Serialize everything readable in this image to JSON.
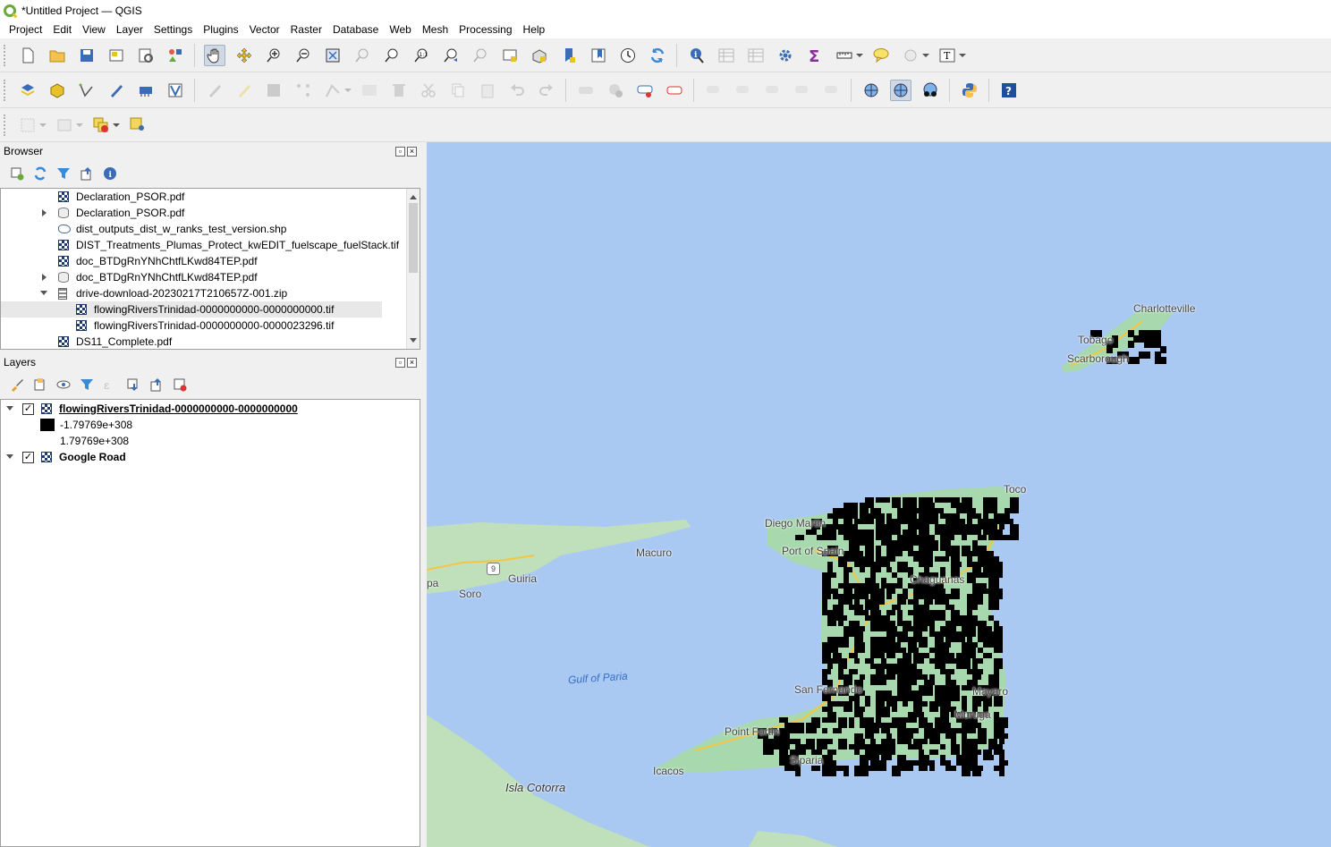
{
  "window": {
    "title": "*Untitled Project — QGIS"
  },
  "menu": [
    "Project",
    "Edit",
    "View",
    "Layer",
    "Settings",
    "Plugins",
    "Vector",
    "Raster",
    "Database",
    "Web",
    "Mesh",
    "Processing",
    "Help"
  ],
  "browser": {
    "title": "Browser",
    "items": [
      {
        "label": "Declaration_PSOR.pdf",
        "icon": "raster",
        "expander": "none",
        "indent": 0
      },
      {
        "label": "Declaration_PSOR.pdf",
        "icon": "database",
        "expander": "collapsed",
        "indent": 0
      },
      {
        "label": "dist_outputs_dist_w_ranks_test_version.shp",
        "icon": "polygon",
        "expander": "none",
        "indent": 0
      },
      {
        "label": "DIST_Treatments_Plumas_Protect_kwEDIT_fuelscape_fuelStack.tif",
        "icon": "raster",
        "expander": "none",
        "indent": 0
      },
      {
        "label": "doc_BTDgRnYNhChtfLKwd84TEP.pdf",
        "icon": "raster",
        "expander": "none",
        "indent": 0
      },
      {
        "label": "doc_BTDgRnYNhChtfLKwd84TEP.pdf",
        "icon": "database",
        "expander": "collapsed",
        "indent": 0
      },
      {
        "label": "drive-download-20230217T210657Z-001.zip",
        "icon": "zip",
        "expander": "expanded",
        "indent": 0
      },
      {
        "label": "flowingRiversTrinidad-0000000000-0000000000.tif",
        "icon": "raster",
        "expander": "none",
        "indent": 1
      },
      {
        "label": "flowingRiversTrinidad-0000000000-0000023296.tif",
        "icon": "raster",
        "expander": "none",
        "indent": 1
      },
      {
        "label": "DS11_Complete.pdf",
        "icon": "raster",
        "expander": "none",
        "indent": 0
      }
    ]
  },
  "layers": {
    "title": "Layers",
    "items": [
      {
        "label": "flowingRiversTrinidad-0000000000-0000000000",
        "checked": "✓"
      },
      {
        "label": "-1.79769e+308",
        "legend": "black-swatch"
      },
      {
        "label": "1.79769e+308",
        "legend": "none"
      },
      {
        "label": "Google Road",
        "checked": "✓"
      }
    ]
  },
  "map": {
    "labels": {
      "charlotteville": "Charlotteville",
      "tobago": "Tobago",
      "scarborough": "Scarborough",
      "toco": "Toco",
      "diego_martin": "Diego Martin",
      "port_of_spain": "Port of Spain",
      "macuro": "Macuro",
      "guiria": "Guiria",
      "soro": "Soro",
      "pa": "pa",
      "route": "9",
      "chaguanas": "Chaguanas",
      "gulf_of_paria": "Gulf of Paria",
      "san_fernando": "San Fernando",
      "mayaro": "Mayaro",
      "point_fortin": "Point Fortin",
      "siparia": "Siparia",
      "moruga": "Moruga",
      "icacos": "Icacos",
      "isla_cotorra": "Isla Cotorra"
    },
    "colors": {
      "sea": "#a9c8f2",
      "land_ven": "#bfe0bb",
      "land_tt": "#a8d9ae",
      "raster": "#000000",
      "road": "#f5c542"
    }
  }
}
